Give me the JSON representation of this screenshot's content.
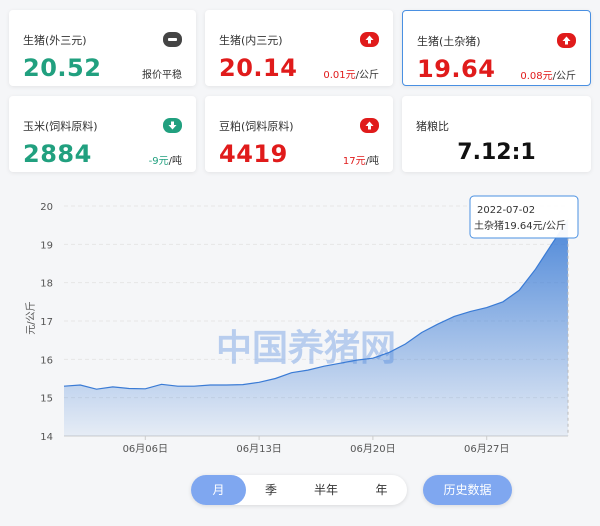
{
  "cards": [
    {
      "title": "生猪(外三元)",
      "value": "20.52",
      "change_num": "报价平稳",
      "change_unit": "",
      "trend": "flat",
      "color": "green"
    },
    {
      "title": "生猪(内三元)",
      "value": "20.14",
      "change_num": "0.01元",
      "change_unit": "/公斤",
      "trend": "up",
      "color": "red"
    },
    {
      "title": "生猪(土杂猪)",
      "value": "19.64",
      "change_num": "0.08元",
      "change_unit": "/公斤",
      "trend": "up",
      "color": "red"
    },
    {
      "title": "玉米(饲料原料)",
      "value": "2884",
      "change_num": "-9元",
      "change_unit": "/吨",
      "trend": "down",
      "color": "green"
    },
    {
      "title": "豆粕(饲料原料)",
      "value": "4419",
      "change_num": "17元",
      "change_unit": "/吨",
      "trend": "up",
      "color": "red"
    }
  ],
  "ratio": {
    "title": "猪粮比",
    "value": "7.12:1"
  },
  "chart_data": {
    "type": "area",
    "ylabel": "元/公斤",
    "ylim": [
      14,
      20
    ],
    "yticks": [
      14,
      15,
      16,
      17,
      18,
      19,
      20
    ],
    "xtick_labels": [
      "06月06日",
      "06月13日",
      "06月20日",
      "06月27日"
    ],
    "xtick_index": [
      5,
      12,
      19,
      26
    ],
    "dates": [
      "06-01",
      "06-02",
      "06-03",
      "06-04",
      "06-05",
      "06-06",
      "06-07",
      "06-08",
      "06-09",
      "06-10",
      "06-11",
      "06-12",
      "06-13",
      "06-14",
      "06-15",
      "06-16",
      "06-17",
      "06-18",
      "06-19",
      "06-20",
      "06-21",
      "06-22",
      "06-23",
      "06-24",
      "06-25",
      "06-26",
      "06-27",
      "06-28",
      "06-29",
      "06-30",
      "07-01",
      "07-02"
    ],
    "values": [
      15.3,
      15.33,
      15.22,
      15.28,
      15.24,
      15.23,
      15.35,
      15.3,
      15.3,
      15.33,
      15.33,
      15.34,
      15.4,
      15.5,
      15.65,
      15.72,
      15.82,
      15.9,
      15.98,
      16.03,
      16.18,
      16.4,
      16.7,
      16.92,
      17.12,
      17.25,
      17.35,
      17.5,
      17.8,
      18.35,
      19.0,
      19.64
    ],
    "tooltip": {
      "date": "2022-07-02",
      "label": "土杂猪19.64元/公斤"
    },
    "watermark": "中国养猪网",
    "color": "#3a7bd5"
  },
  "tabs": [
    "月",
    "季",
    "半年",
    "年"
  ],
  "active_tab": 0,
  "history_button": "历史数据"
}
